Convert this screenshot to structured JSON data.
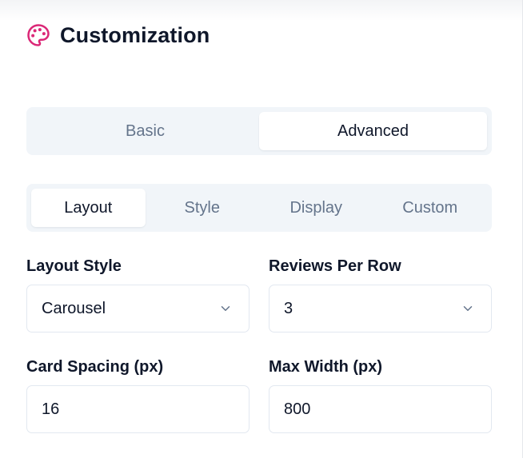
{
  "header": {
    "title": "Customization",
    "icon": "palette-icon",
    "accent_color": "#db2777"
  },
  "mode_tabs": [
    {
      "label": "Basic",
      "active": false
    },
    {
      "label": "Advanced",
      "active": true
    }
  ],
  "sub_tabs": [
    {
      "label": "Layout",
      "active": true
    },
    {
      "label": "Style",
      "active": false
    },
    {
      "label": "Display",
      "active": false
    },
    {
      "label": "Custom",
      "active": false
    }
  ],
  "fields": {
    "layout_style": {
      "label": "Layout Style",
      "value": "Carousel",
      "icon": "chevron-down-icon"
    },
    "reviews_per_row": {
      "label": "Reviews Per Row",
      "value": "3",
      "icon": "chevron-down-icon"
    },
    "card_spacing": {
      "label": "Card Spacing (px)",
      "value": "16"
    },
    "max_width": {
      "label": "Max Width (px)",
      "value": "800"
    }
  }
}
